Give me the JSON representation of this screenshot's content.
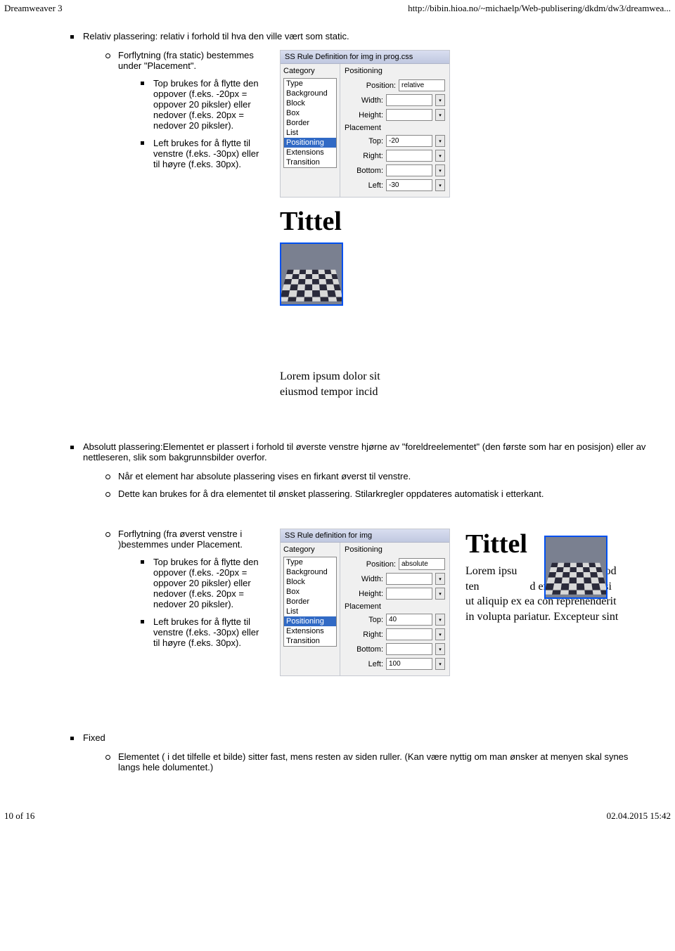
{
  "header": {
    "left": "Dreamweaver 3",
    "right": "http://bibin.hioa.no/~michaelp/Web-publisering/dkdm/dw3/dreamwea..."
  },
  "footer": {
    "left": "10 of 16",
    "right": "02.04.2015 15:42"
  },
  "relative": {
    "heading": "Relativ plassering: relativ i forhold til hva den ville vært som static.",
    "sub_heading": "Forflytning (fra static) bestemmes under \"Placement\".",
    "item_top": "Top brukes for å flytte den oppover (f.eks. -20px = oppover 20 piksler) eller nedover (f.eks. 20px = nedover 20 piksler).",
    "item_left": "Left brukes for å flytte til venstre (f.eks. -30px) eller til høyre (f.eks. 30px)."
  },
  "panel1": {
    "title": "SS Rule Definition for img in prog.css",
    "cat_label": "Category",
    "prop_label": "Positioning",
    "categories": [
      "Type",
      "Background",
      "Block",
      "Box",
      "Border",
      "List",
      "Positioning",
      "Extensions",
      "Transition"
    ],
    "selected_index": 6,
    "fields": {
      "position": {
        "label": "Position:",
        "value": "relative"
      },
      "width": {
        "label": "Width:",
        "value": ""
      },
      "height": {
        "label": "Height:",
        "value": ""
      },
      "placement": {
        "label": "Placement"
      },
      "top": {
        "label": "Top:",
        "value": "-20"
      },
      "right": {
        "label": "Right:",
        "value": ""
      },
      "bottom": {
        "label": "Bottom:",
        "value": ""
      },
      "left": {
        "label": "Left:",
        "value": "-30"
      }
    }
  },
  "preview1": {
    "title": "Tittel",
    "lorem_l1": "Lorem ipsum dolor sit",
    "lorem_l2": "eiusmod tempor incid"
  },
  "absolute": {
    "heading": "Absolutt plassering:Elementet er plassert i forhold til øverste venstre hjørne av \"foreldreelementet\" (den første som har en posisjon) eller av nettleseren, slik som bakgrunnsbilder overfor.",
    "item_a": "Når et element har absolute plassering vises en firkant øverst til venstre.",
    "item_b": "Dette kan brukes for å dra elementet til ønsket plassering. Stilarkregler oppdateres automatisk i etterkant.",
    "sub_heading": "Forflytning (fra øverst venstre i )bestemmes under Placement.",
    "item_top": "Top brukes for å flytte den oppover (f.eks. -20px = oppover 20 piksler) eller nedover (f.eks. 20px = nedover 20 piksler).",
    "item_left": "Left brukes for å flytte til venstre (f.eks. -30px) eller til høyre (f.eks. 30px)."
  },
  "panel2": {
    "title": "SS Rule definition for img",
    "cat_label": "Category",
    "prop_label": "Positioning",
    "categories": [
      "Type",
      "Background",
      "Block",
      "Box",
      "Border",
      "List",
      "Positioning",
      "Extensions",
      "Transition"
    ],
    "selected_index": 6,
    "fields": {
      "position": {
        "label": "Position:",
        "value": "absolute"
      },
      "width": {
        "label": "Width:",
        "value": ""
      },
      "height": {
        "label": "Height:",
        "value": ""
      },
      "placement": {
        "label": "Placement"
      },
      "top": {
        "label": "Top:",
        "value": "40"
      },
      "right": {
        "label": "Right:",
        "value": ""
      },
      "bottom": {
        "label": "Bottom:",
        "value": ""
      },
      "left": {
        "label": "Left:",
        "value": "100"
      }
    }
  },
  "preview2": {
    "title": "Tittel",
    "text": "Lorem ipsu                   a eiusmod ten                  d enim ad mir nisi ut aliquip ex ea con reprehenderit in volupta pariatur. Excepteur sint"
  },
  "fixed": {
    "heading": "Fixed",
    "item": "Elementet ( i det tilfelle et bilde) sitter fast, mens resten av siden ruller. (Kan være nyttig om man ønsker at menyen skal synes langs hele dolumentet.)"
  }
}
